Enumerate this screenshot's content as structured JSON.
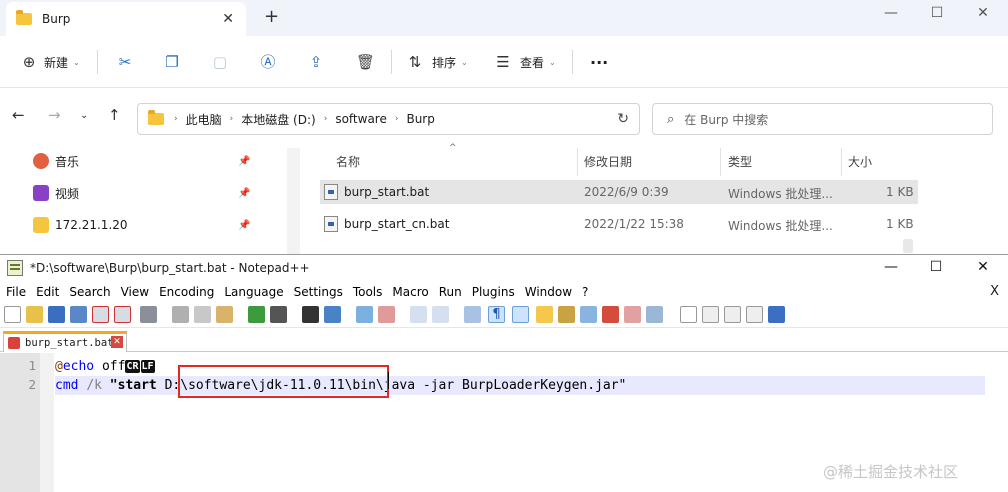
{
  "explorer": {
    "tab_title": "Burp",
    "toolbar": {
      "new_label": "新建",
      "sort_label": "排序",
      "view_label": "查看",
      "more_label": "···"
    },
    "breadcrumbs": [
      "此电脑",
      "本地磁盘 (D:)",
      "software",
      "Burp"
    ],
    "search_placeholder": "在 Burp 中搜索",
    "nav_items": [
      {
        "label": "音乐",
        "icon": "music-icon",
        "color": "#e06040"
      },
      {
        "label": "视频",
        "icon": "video-icon",
        "color": "#8a3fc7"
      },
      {
        "label": "172.21.1.20",
        "icon": "network-folder-icon",
        "color": "#f5c53d"
      }
    ],
    "columns": {
      "name": "名称",
      "date": "修改日期",
      "type": "类型",
      "size": "大小"
    },
    "files": [
      {
        "name": "burp_start.bat",
        "date": "2022/6/9 0:39",
        "type": "Windows 批处理...",
        "size": "1 KB",
        "selected": true
      },
      {
        "name": "burp_start_cn.bat",
        "date": "2022/1/22 15:38",
        "type": "Windows 批处理...",
        "size": "1 KB",
        "selected": false
      }
    ]
  },
  "npp": {
    "title": "*D:\\software\\Burp\\burp_start.bat - Notepad++",
    "menu": [
      "File",
      "Edit",
      "Search",
      "View",
      "Encoding",
      "Language",
      "Settings",
      "Tools",
      "Macro",
      "Run",
      "Plugins",
      "Window",
      "?"
    ],
    "menu_close": "X",
    "tab_label": "burp_start.bat",
    "line_numbers": [
      "1",
      "2"
    ],
    "line1": {
      "at": "@",
      "kw": "echo",
      "rest": " off",
      "eol1": "CR",
      "eol2": "LF"
    },
    "line2": {
      "cmd": "cmd",
      "space1": " ",
      "opt": "/k",
      "space2": " ",
      "start": "\"start",
      "path": " D:\\software\\jdk-11.0.11",
      "tail": "\\bin\\java -jar BurpLoaderKeygen.jar\""
    }
  },
  "watermark": "@稀土掘金技术社区"
}
